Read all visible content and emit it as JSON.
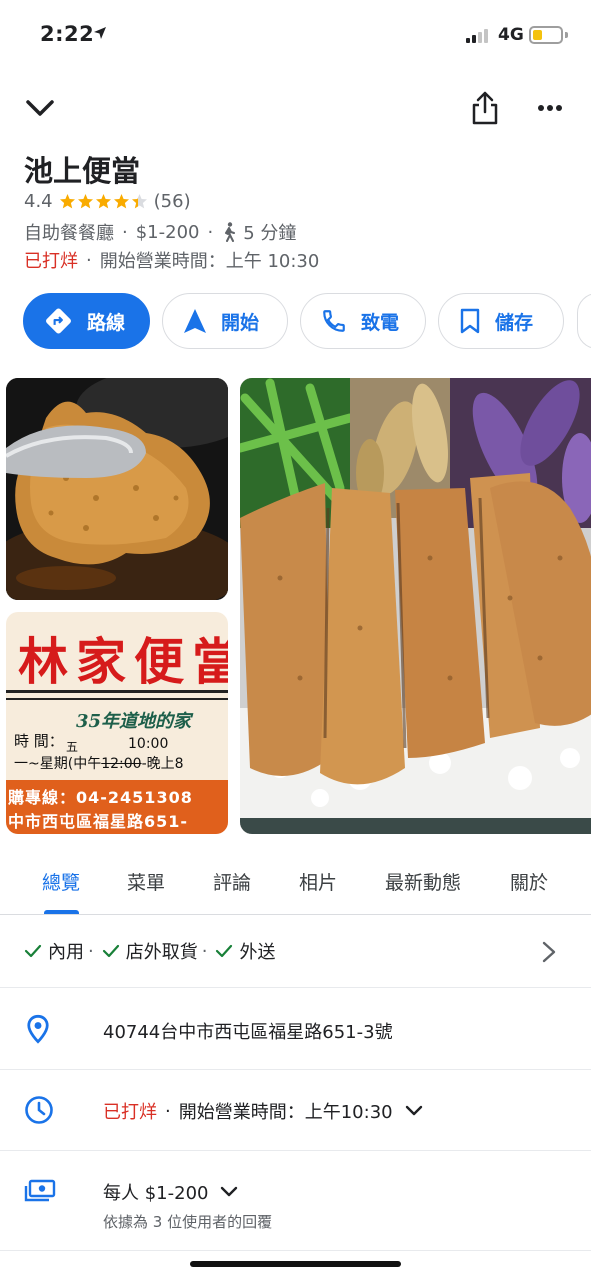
{
  "status": {
    "time": "2:22",
    "network": "4G"
  },
  "place": {
    "name": "池上便當",
    "rating": "4.4",
    "star_fill": 4.4,
    "review_count": "(56)",
    "category": "自助餐餐廳",
    "price_range": "$1-200",
    "walk_time": "5 分鐘",
    "status_closed": "已打烊",
    "opens": "開始營業時間：上午 10:30"
  },
  "actions": [
    {
      "label": "路線",
      "icon": "directions-icon"
    },
    {
      "label": "開始",
      "icon": "navigation-arrow-icon"
    },
    {
      "label": "致電",
      "icon": "phone-icon"
    },
    {
      "label": "儲存",
      "icon": "bookmark-icon"
    }
  ],
  "photos": {
    "sign": {
      "title": "林家便當",
      "subtitle": "35年道地的家",
      "hours_label": "時 間：",
      "weekday_note": "五",
      "time_note": "10:00",
      "hours_line": "一~星期",
      "hours_line2": "(中午",
      "hours_struck": "12:00",
      "hours_line3": "-晚上8",
      "phone_line": "購專線：04-2451308",
      "address_line": "中市西屯區福星路651-"
    }
  },
  "tabs": [
    "總覽",
    "菜單",
    "評論",
    "相片",
    "最新動態",
    "關於"
  ],
  "active_tab": 0,
  "services": [
    "內用",
    "店外取貨",
    "外送"
  ],
  "address": "40744台中市西屯區福星路651-3號",
  "hours_row": {
    "status": "已打烊",
    "text": "開始營業時間：上午10:30"
  },
  "price_row": {
    "text": "每人 $1-200",
    "note": "依據為 3 位使用者的回覆"
  },
  "colors": {
    "accent": "#1a73e8",
    "closed": "#d93025",
    "star": "#f9ab00",
    "check": "#188038"
  }
}
